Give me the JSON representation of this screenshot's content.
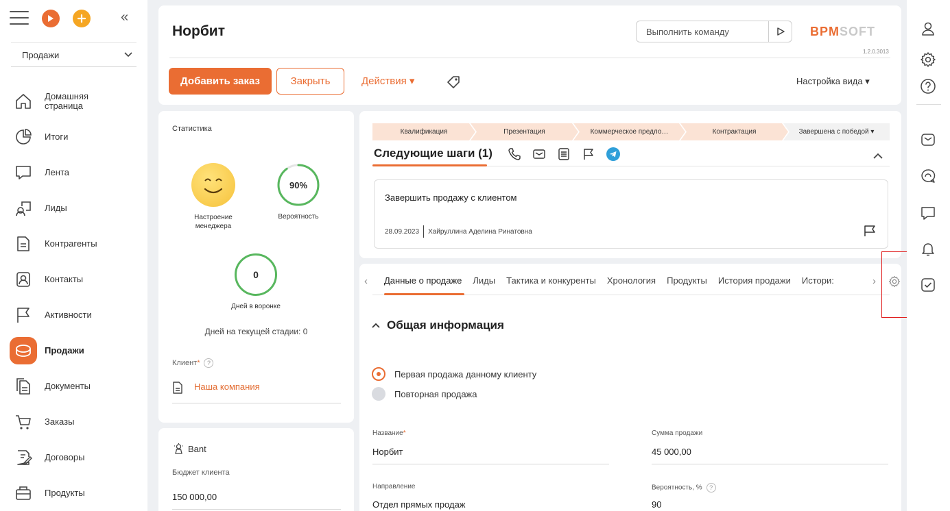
{
  "sidebar": {
    "section_select": "Продажи",
    "items": [
      {
        "label": "Домашняя страница",
        "icon": "home-icon"
      },
      {
        "label": "Итоги",
        "icon": "pie-chart-icon"
      },
      {
        "label": "Лента",
        "icon": "chat-bubble-icon"
      },
      {
        "label": "Лиды",
        "icon": "leads-icon"
      },
      {
        "label": "Контрагенты",
        "icon": "accounts-icon"
      },
      {
        "label": "Контакты",
        "icon": "contacts-icon"
      },
      {
        "label": "Активности",
        "icon": "flag-icon"
      },
      {
        "label": "Продажи",
        "icon": "sales-icon",
        "active": true
      },
      {
        "label": "Документы",
        "icon": "documents-icon"
      },
      {
        "label": "Заказы",
        "icon": "cart-icon"
      },
      {
        "label": "Договоры",
        "icon": "contracts-icon"
      },
      {
        "label": "Продукты",
        "icon": "products-icon"
      }
    ]
  },
  "header": {
    "title": "Норбит",
    "command_placeholder": "Выполнить команду",
    "logo_main": "BPM",
    "logo_soft": "SOFT",
    "version": "1.2.0.3013",
    "add_order": "Добавить заказ",
    "close": "Закрыть",
    "actions": "Действия ▾",
    "view_settings": "Настройка вида ▾"
  },
  "stats": {
    "title": "Статистика",
    "mood_label": "Настроение менеджера",
    "probability_value": "90%",
    "probability_fraction": 0.9,
    "probability_label": "Вероятность",
    "days_value": "0",
    "days_label": "Дней в воронке",
    "stage_days": "Дней на текущей стадии: 0",
    "client_label": "Клиент",
    "client_req": "*",
    "client_help": "?",
    "client_value": "Наша компания"
  },
  "bant": {
    "title": "Bant",
    "budget_label": "Бюджет клиента",
    "budget_value": "150 000,00"
  },
  "stages": [
    "Квалификация",
    "Презентация",
    "Коммерческое предло…",
    "Контрактация",
    "Завершена с победой ▾"
  ],
  "next_steps": {
    "title": "Следующие шаги (1)",
    "task_title": "Завершить продажу с клиентом",
    "task_date": "28.09.2023",
    "task_owner": "Хайруллина Аделина Ринатовна"
  },
  "tabs": [
    "Данные о продаже",
    "Лиды",
    "Тактика и конкуренты",
    "Хронология",
    "Продукты",
    "История продажи",
    "Истори:"
  ],
  "details": {
    "section_title": "Общая информация",
    "radio_first": "Первая продажа данному клиенту",
    "radio_repeat": "Повторная продажа",
    "name_label": "Название",
    "name_req": "*",
    "name_value": "Норбит",
    "amount_label": "Сумма продажи",
    "amount_value": "45 000,00",
    "direction_label": "Направление",
    "direction_value": "Отдел прямых продаж",
    "probability_label": "Вероятность, %",
    "probability_help": "?",
    "probability_value": "90"
  },
  "colors": {
    "accent": "#ea6d33",
    "success": "#58b75e",
    "highlight": "#e02020"
  }
}
